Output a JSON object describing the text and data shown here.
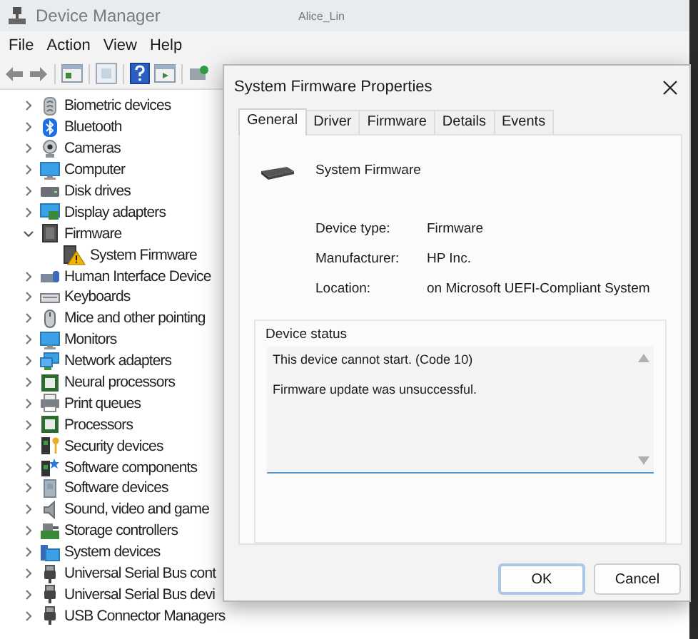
{
  "window": {
    "title": "Device Manager",
    "user": "Alice_Lin"
  },
  "menu": [
    "File",
    "Action",
    "View",
    "Help"
  ],
  "tree": [
    {
      "label": "Biometric devices",
      "expanded": false
    },
    {
      "label": "Bluetooth",
      "expanded": false
    },
    {
      "label": "Cameras",
      "expanded": false
    },
    {
      "label": "Computer",
      "expanded": false
    },
    {
      "label": "Disk drives",
      "expanded": false
    },
    {
      "label": "Display adapters",
      "expanded": false
    },
    {
      "label": "Firmware",
      "expanded": true,
      "children": [
        {
          "label": "System Firmware",
          "warning": true
        }
      ]
    },
    {
      "label": "Human Interface Device",
      "expanded": false
    },
    {
      "label": "Keyboards",
      "expanded": false
    },
    {
      "label": "Mice and other pointing",
      "expanded": false
    },
    {
      "label": "Monitors",
      "expanded": false
    },
    {
      "label": "Network adapters",
      "expanded": false
    },
    {
      "label": "Neural processors",
      "expanded": false
    },
    {
      "label": "Print queues",
      "expanded": false
    },
    {
      "label": "Processors",
      "expanded": false
    },
    {
      "label": "Security devices",
      "expanded": false
    },
    {
      "label": "Software components",
      "expanded": false
    },
    {
      "label": "Software devices",
      "expanded": false
    },
    {
      "label": "Sound, video and game",
      "expanded": false
    },
    {
      "label": "Storage controllers",
      "expanded": false
    },
    {
      "label": "System devices",
      "expanded": false
    },
    {
      "label": "Universal Serial Bus cont",
      "expanded": false
    },
    {
      "label": "Universal Serial Bus devi",
      "expanded": false
    },
    {
      "label": "USB Connector Managers",
      "expanded": false
    }
  ],
  "dialog": {
    "title": "System Firmware Properties",
    "tabs": [
      {
        "label": "General",
        "selected": true
      },
      {
        "label": "Driver",
        "selected": false
      },
      {
        "label": "Firmware",
        "selected": false
      },
      {
        "label": "Details",
        "selected": false
      },
      {
        "label": "Events",
        "selected": false
      }
    ],
    "device_name": "System Firmware",
    "properties": [
      {
        "label": "Device type:",
        "value": "Firmware"
      },
      {
        "label": "Manufacturer:",
        "value": "HP Inc."
      },
      {
        "label": "Location:",
        "value": "on Microsoft UEFI-Compliant System"
      }
    ],
    "status_group": "Device status",
    "status_lines": [
      "This device cannot start. (Code 10)",
      "Firmware update was unsuccessful."
    ],
    "buttons": [
      {
        "label": "OK",
        "focused": true
      },
      {
        "label": "Cancel",
        "focused": false
      }
    ]
  }
}
